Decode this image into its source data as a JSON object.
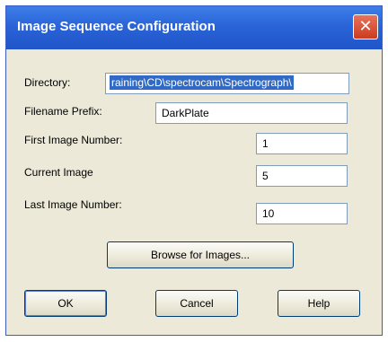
{
  "window": {
    "title": "Image Sequence Configuration"
  },
  "fields": {
    "directory": {
      "label": "Directory:",
      "value": "raining\\CD\\spectrocam\\Spectrograph\\"
    },
    "filename_prefix": {
      "label": "Filename Prefix:",
      "value": "DarkPlate"
    },
    "first_image": {
      "label": "First Image Number:",
      "value": "1"
    },
    "current_image": {
      "label": "Current Image",
      "value": "5"
    },
    "last_image": {
      "label": "Last Image Number:",
      "value": "10"
    }
  },
  "buttons": {
    "browse": "Browse for Images...",
    "ok": "OK",
    "cancel": "Cancel",
    "help": "Help"
  },
  "colors": {
    "titlebar": "#2a64d8",
    "close": "#cc3b1e",
    "face": "#ece9d8",
    "selection": "#316ac5"
  }
}
